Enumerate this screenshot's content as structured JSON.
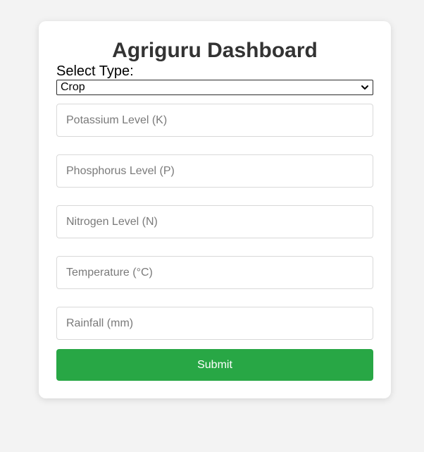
{
  "title": "Agriguru Dashboard",
  "type_select": {
    "label": "Select Type:",
    "selected": "Crop"
  },
  "fields": {
    "potassium": {
      "placeholder": "Potassium Level (K)",
      "value": ""
    },
    "phosphorus": {
      "placeholder": "Phosphorus Level (P)",
      "value": ""
    },
    "nitrogen": {
      "placeholder": "Nitrogen Level (N)",
      "value": ""
    },
    "temperature": {
      "placeholder": "Temperature (°C)",
      "value": ""
    },
    "rainfall": {
      "placeholder": "Rainfall (mm)",
      "value": ""
    }
  },
  "submit_label": "Submit",
  "colors": {
    "background": "#f3f3f3",
    "card": "#ffffff",
    "accent": "#28a745",
    "title": "#333333"
  },
  "icons": {
    "select_arrow": "chevron-down-icon"
  }
}
